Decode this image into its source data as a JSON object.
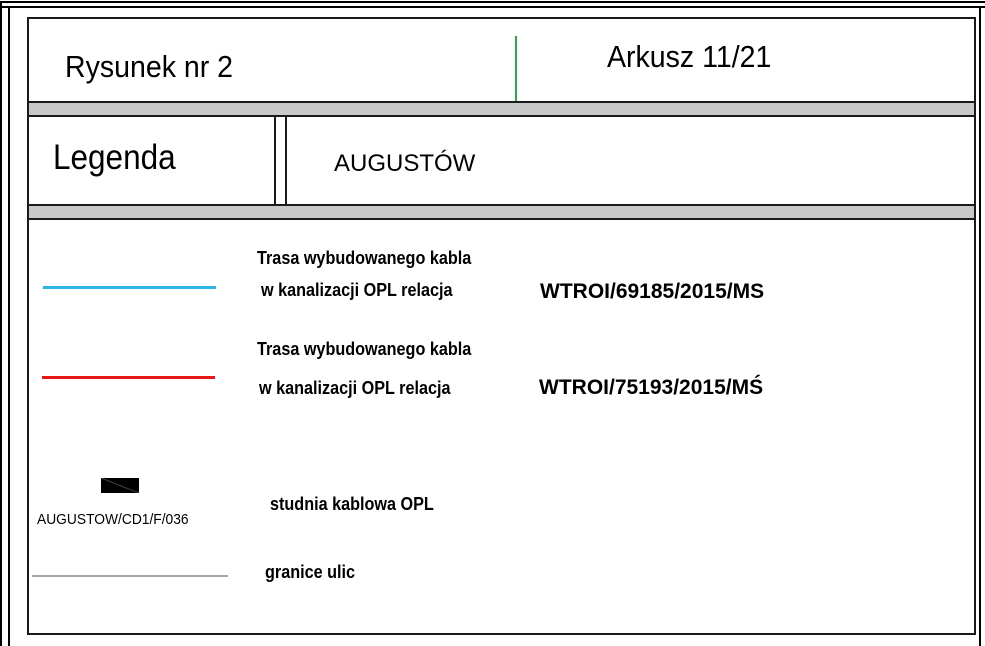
{
  "header": {
    "drawing_number": "Rysunek nr 2",
    "sheet_number": "Arkusz 11/21"
  },
  "legend_header": {
    "title": "Legenda",
    "town": "AUGUSTÓW"
  },
  "legend": {
    "items": [
      {
        "line_color": "#2bb5e8",
        "line1": "Trasa wybudowanego kabla",
        "line2": "w kanalizacji OPL relacja",
        "code": "WTROI/69185/2015/MS"
      },
      {
        "line_color": "#e81818",
        "line1": "Trasa wybudowanego kabla",
        "line2": "w kanalizacji OPL relacja",
        "code": "WTROI/75193/2015/MŚ"
      }
    ],
    "manhole": {
      "symbol": "manhole-symbol",
      "label": "AUGUSTOW/CD1/F/036",
      "description": "studnia kablowa OPL"
    },
    "street_border": {
      "line_color": "#a6a6a6",
      "description": "granice ulic"
    }
  }
}
